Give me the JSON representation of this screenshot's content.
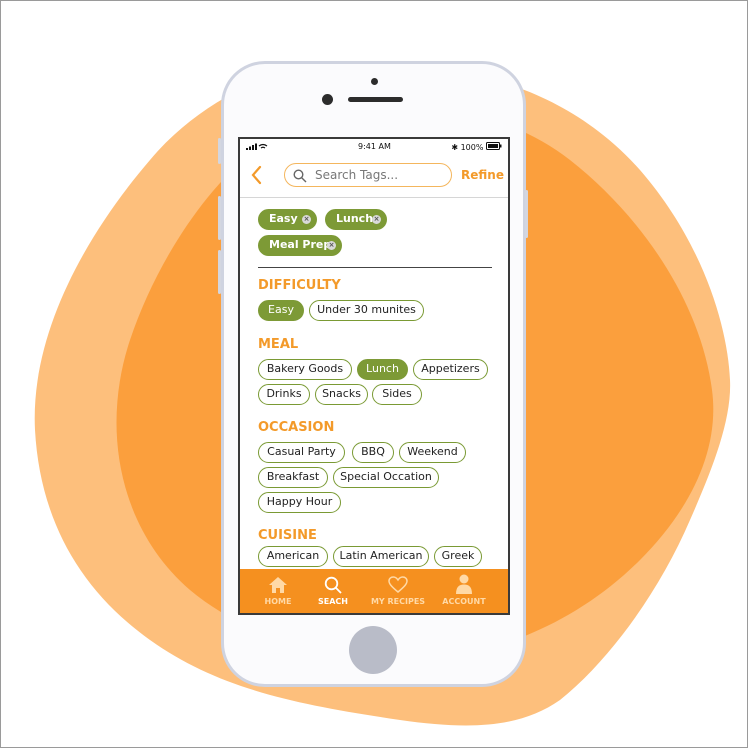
{
  "status_bar": {
    "time": "9:41 AM",
    "battery": "100%"
  },
  "header": {
    "search_placeholder": "Search Tags...",
    "refine_label": "Refine"
  },
  "selected_tags": [
    {
      "label": "Easy"
    },
    {
      "label": "Lunch"
    },
    {
      "label": "Meal Prep"
    }
  ],
  "sections": {
    "difficulty": {
      "title": "DIFFICULTY",
      "tags": [
        "Easy",
        "Under 30 munites"
      ],
      "active": [
        "Easy"
      ]
    },
    "meal": {
      "title": "MEAL",
      "tags": [
        "Bakery Goods",
        "Lunch",
        "Appetizers",
        "Drinks",
        "Snacks",
        "Sides"
      ],
      "active": [
        "Lunch"
      ]
    },
    "occasion": {
      "title": "OCCASION",
      "tags": [
        "Casual Party",
        "BBQ",
        "Weekend",
        "Breakfast",
        "Special Occation",
        "Happy Hour"
      ]
    },
    "cuisine": {
      "title": "CUISINE",
      "tags": [
        "American",
        "Latin American",
        "Greek"
      ]
    }
  },
  "tabbar": {
    "items": [
      {
        "label": "HOME",
        "icon": "home-icon"
      },
      {
        "label": "SEACH",
        "icon": "search-icon",
        "active": true
      },
      {
        "label": "MY RECIPES",
        "icon": "heart-icon"
      },
      {
        "label": "ACCOUNT",
        "icon": "person-icon"
      }
    ]
  },
  "colors": {
    "accent": "#f39a2a",
    "tag_green": "#7d9a36",
    "blob_light": "#fdbf7c",
    "blob_dark": "#fb9f3d"
  }
}
